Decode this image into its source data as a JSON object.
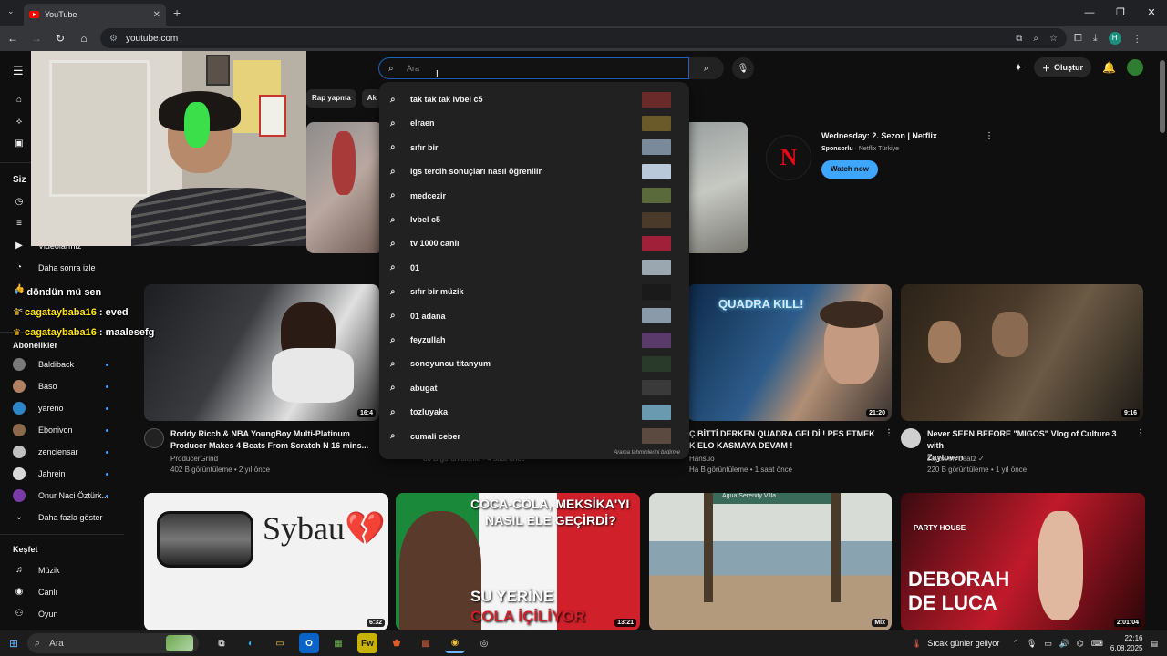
{
  "browser": {
    "tab_title": "YouTube",
    "url": "youtube.com",
    "new_tab": "+",
    "close_tab": "✕",
    "minimize": "—",
    "restore": "❐",
    "close_window": "✕"
  },
  "youtube": {
    "search_placeholder": "Ara",
    "create_label": "Oluştur",
    "chips": [
      "Rap yapma",
      "Ak"
    ],
    "suggestions": [
      {
        "text": "tak tak tak lvbel c5",
        "thumb": "#6b2a2a"
      },
      {
        "text": "elraen",
        "thumb": "#6a5a2a"
      },
      {
        "text": "sıfır bir",
        "thumb": "#7a8a9a"
      },
      {
        "text": "lgs tercih sonuçları nasıl öğrenilir",
        "thumb": "#b9c9d9"
      },
      {
        "text": "medcezir",
        "thumb": "#5a6a3a"
      },
      {
        "text": "lvbel c5",
        "thumb": "#4a3a2a"
      },
      {
        "text": "tv 1000 canlı",
        "thumb": "#a0203a"
      },
      {
        "text": "01",
        "thumb": "#9aa6b0"
      },
      {
        "text": "sıfır bir müzik",
        "thumb": "#1a1a1a"
      },
      {
        "text": "01 adana",
        "thumb": "#8a9aa8"
      },
      {
        "text": "feyzullah",
        "thumb": "#5a3a6a"
      },
      {
        "text": "sonoyuncu titanyum",
        "thumb": "#2a3a2a"
      },
      {
        "text": "abugat",
        "thumb": "#3a3a3a"
      },
      {
        "text": "tozluyaka",
        "thumb": "#6a9ab0"
      },
      {
        "text": "cumali ceber",
        "thumb": "#5a4a40"
      }
    ],
    "suggest_footer": "Arama tahminlerini bildirme",
    "sidebar": {
      "siz": "Siz",
      "videolariniz": "Videolarınız",
      "sonra": "Daha sonra izle",
      "abonelikler": "Abonelikler",
      "subs": [
        {
          "name": "Baldiback",
          "color": "#7a7a7a"
        },
        {
          "name": "Baso",
          "color": "#b08060"
        },
        {
          "name": "yareno",
          "color": "#2a88c8"
        },
        {
          "name": "Ebonivon",
          "color": "#8a6a4a"
        },
        {
          "name": "zenciensar",
          "color": "#c0c0c0"
        },
        {
          "name": "Jahrein",
          "color": "#d8d8d8"
        },
        {
          "name": "Onur Naci Öztürk...",
          "color": "#7a3aa8"
        }
      ],
      "more": "Daha fazla göster",
      "kesfet": "Keşfet",
      "muzik": "Müzik",
      "canli": "Canlı",
      "oyun": "Oyun"
    },
    "chat": [
      {
        "user": "",
        "msg": "döndün mü sen"
      },
      {
        "user": "cagataybaba16",
        "msg": ": eved"
      },
      {
        "user": "cagataybaba16",
        "msg": ": maalesefg"
      }
    ],
    "ad": {
      "logo": "N",
      "title": "Wednesday: 2. Sezon | Netflix",
      "sponsored": "Sponsorlu",
      "advertiser": "· Netflix Türkiye",
      "button": "Watch now"
    },
    "videos_row1": [
      {
        "title1": "Roddy Ricch & NBA YoungBoy Multi-Platinum",
        "title2": "Producer Makes 4 Beats From Scratch N 16 mins...",
        "channel": "ProducerGrind",
        "meta": "402 B görüntüleme • 2 yıl önce",
        "duration": "16:4"
      },
      {
        "title1": "",
        "title2": "",
        "channel": "",
        "meta": "80 B görüntüleme • 4 saat önce",
        "duration": ""
      },
      {
        "title1": "Ç BİTTİ DERKEN QUADRA GELDİ ! PES ETMEK",
        "title2": "K ELO KASMAYA DEVAM !",
        "channel": "Hansuo",
        "meta": "Ha B görüntüleme • 1 saat önce",
        "duration": "21:20",
        "overlay": "QUADRA KILL!"
      },
      {
        "title1": "Never SEEN BEFORE \"MIGOS\" Vlog of Culture 3 with",
        "title2": "Zaytoven",
        "channel": "zaytoven beatz ✓",
        "meta": "220 B görüntüleme • 1 yıl önce",
        "duration": "9:16"
      }
    ],
    "videos_row2": [
      {
        "overlay": "Sybau💔",
        "duration": "6:32"
      },
      {
        "overlay1": "COCA-COLA, MEKSİKA'YI",
        "overlay2": "NASIL ELE GEÇİRDİ?",
        "overlay3": "SU YERİNE",
        "overlay4": "COLA İÇİLİYOR",
        "duration": "13:21"
      },
      {
        "overlay": "Agua Serenity Villa",
        "duration": "Mix"
      },
      {
        "overlay1": "PARTY HOUSE",
        "overlay2": "DEBORAH",
        "overlay3": "DE LUCA",
        "duration": "2:01:04"
      }
    ]
  },
  "taskbar": {
    "search_placeholder": "Ara",
    "weather": "Sıcak günler geliyor",
    "time": "22:16",
    "date": "6.08.2025"
  }
}
